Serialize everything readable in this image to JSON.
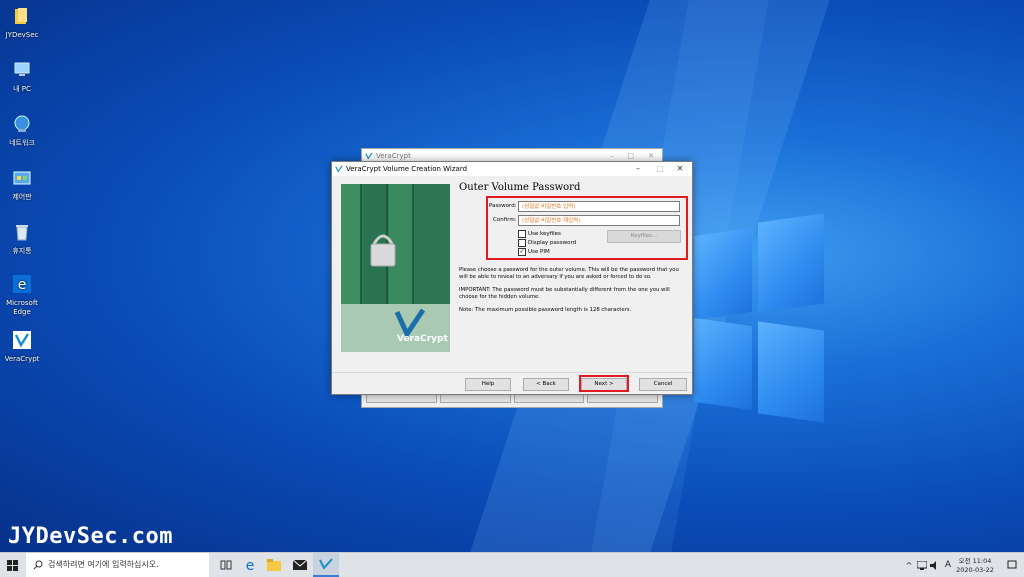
{
  "desktop": {
    "icons": [
      {
        "label": "JYDevSec",
        "icon": "folder-icon"
      },
      {
        "label": "내 PC",
        "icon": "computer-icon"
      },
      {
        "label": "네트워크",
        "icon": "network-icon"
      },
      {
        "label": "제어판",
        "icon": "control-panel-icon"
      },
      {
        "label": "휴지통",
        "icon": "recycle-bin-icon"
      },
      {
        "label": "Microsoft Edge",
        "icon": "edge-icon"
      },
      {
        "label": "VeraCrypt",
        "icon": "veracrypt-icon"
      }
    ],
    "watermark": "JYDevSec.com"
  },
  "background_window": {
    "title": "VeraCrypt"
  },
  "wizard": {
    "title": "VeraCrypt Volume Creation Wizard",
    "page_title": "Outer Volume Password",
    "password_label": "Password:",
    "password_value": "(성질없 비밀번호 입력)",
    "confirm_label": "Confirm:",
    "confirm_value": "(성질없 비밀번호 재입력)",
    "use_keyfiles": {
      "label": "Use keyfiles",
      "checked": false
    },
    "display_password": {
      "label": "Display password",
      "checked": false
    },
    "use_pim": {
      "label": "Use PIM",
      "checked": true
    },
    "keyfiles_button": "Keyfiles...",
    "paragraph1": "Please choose a password for the outer volume. This will be the password that you will be able to reveal to an adversary if you are asked or forced to do so.",
    "paragraph2": "IMPORTANT: The password must be substantially different from the one you will choose for the hidden volume.",
    "paragraph3": "Note: The maximum possible password length is 128 characters.",
    "art_brand": "VeraCrypt",
    "buttons": {
      "help": "Help",
      "back": "< Back",
      "next": "Next >",
      "cancel": "Cancel"
    },
    "highlight_color": "#e01b24"
  },
  "taskbar": {
    "search_placeholder": "검색하려면 여기에 입력하십시오.",
    "time": "오전 11:04",
    "date": "2020-03-22",
    "ime": "A",
    "pinned": [
      "task-view-icon",
      "edge-icon",
      "file-explorer-icon",
      "mail-icon",
      "veracrypt-icon"
    ]
  }
}
